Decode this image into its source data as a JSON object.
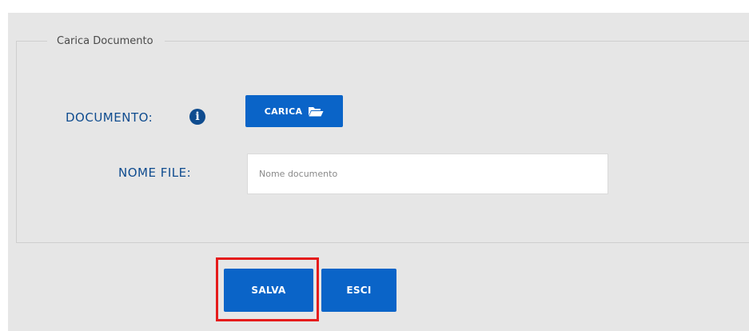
{
  "form": {
    "legend": "Carica Documento",
    "documento_label": "DOCUMENTO:",
    "info_icon_glyph": "i",
    "carica_button_label": "CARICA",
    "nome_file_label": "NOME FILE:",
    "nome_file_placeholder": "Nome documento",
    "nome_file_value": ""
  },
  "actions": {
    "salva_label": "SALVA",
    "esci_label": "ESCI"
  },
  "icons": {
    "info": "info-circle-icon",
    "folder": "folder-open-icon"
  },
  "colors": {
    "button_blue": "#0a64c8",
    "label_blue": "#0f4c8f",
    "panel_gray": "#e6e6e6",
    "highlight_red": "#e51c1c"
  }
}
